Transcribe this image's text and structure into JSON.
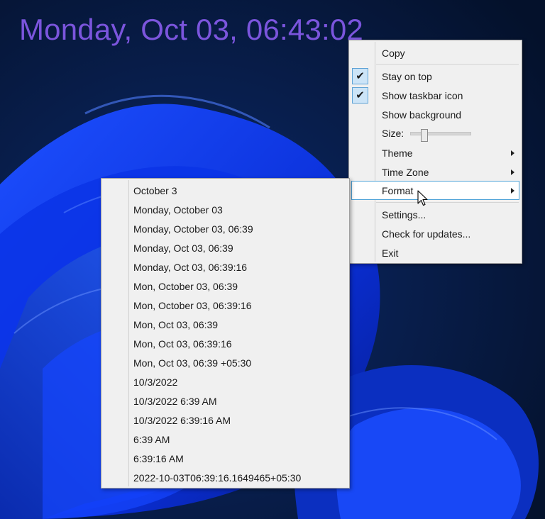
{
  "clock": {
    "text": "Monday, Oct 03, 06:43:02",
    "color": "#7b55dd"
  },
  "context_menu": {
    "copy": "Copy",
    "stay_on_top": "Stay on top",
    "show_taskbar_icon": "Show taskbar icon",
    "show_background": "Show background",
    "size": "Size:",
    "size_level": 0.2,
    "theme": "Theme",
    "time_zone": "Time Zone",
    "format": "Format",
    "settings": "Settings...",
    "check_updates": "Check for updates...",
    "exit": "Exit",
    "check_glyph": "✔"
  },
  "format_menu": {
    "items": [
      "October 3",
      "Monday, October 03",
      "Monday, October 03, 06:39",
      "Monday, Oct 03, 06:39",
      "Monday, Oct 03, 06:39:16",
      "Mon, October 03, 06:39",
      "Mon, October 03, 06:39:16",
      "Mon, Oct 03, 06:39",
      "Mon, Oct 03, 06:39:16",
      "Mon, Oct 03, 06:39 +05:30",
      "10/3/2022",
      "10/3/2022 6:39 AM",
      "10/3/2022 6:39:16 AM",
      "6:39 AM",
      "6:39:16 AM",
      "2022-10-03T06:39:16.1649465+05:30"
    ]
  },
  "colors": {
    "highlight_border": "#4fa3d8",
    "check_bg": "#cce4f7",
    "menu_bg": "#f0f0f0"
  }
}
